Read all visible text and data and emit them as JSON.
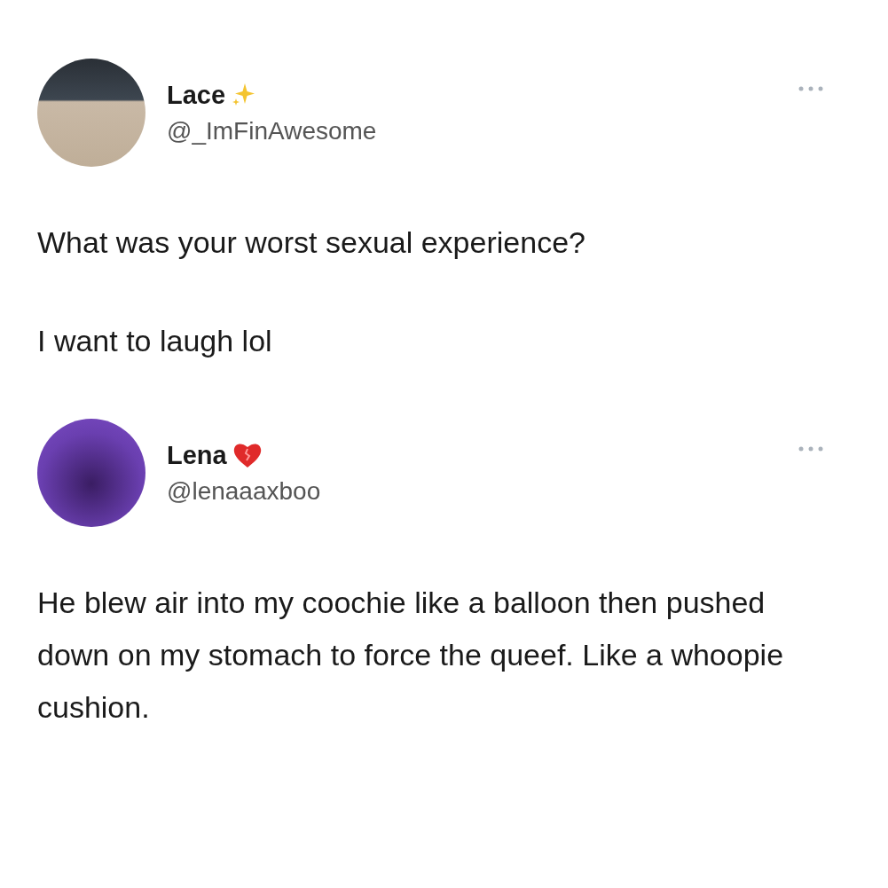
{
  "tweets": [
    {
      "name": "Lace",
      "handle": "@_ImFinAwesome",
      "kind": "sparkles",
      "paragraphs": [
        "What was your worst sexual experience?",
        "I want to laugh lol"
      ]
    },
    {
      "name": "Lena",
      "handle": "@lenaaaxboo",
      "kind": "heart",
      "paragraphs": [
        "He blew air into my coochie like a balloon then pushed down on my stomach to force the queef. Like a whoopie cushion."
      ]
    }
  ]
}
